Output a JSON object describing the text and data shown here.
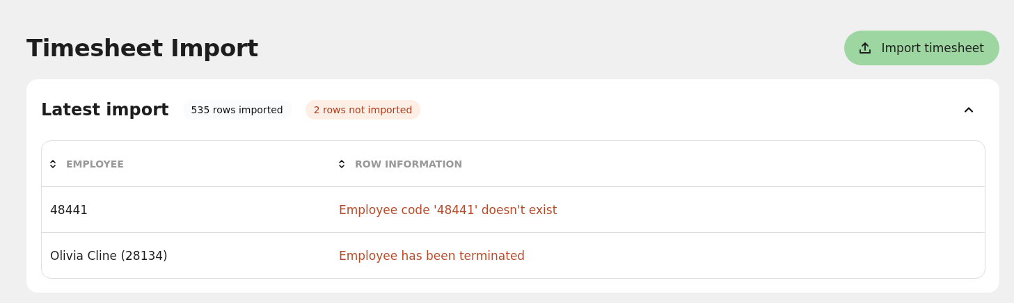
{
  "page": {
    "title": "Timesheet Import"
  },
  "import_button": {
    "label": "Import timesheet"
  },
  "latest_import": {
    "title": "Latest import",
    "expanded": true,
    "badges": [
      {
        "label": "535 rows imported",
        "kind": "success"
      },
      {
        "label": "2 rows not imported",
        "kind": "error"
      }
    ],
    "table": {
      "columns": [
        "EMPLOYEE",
        "ROW INFORMATION"
      ],
      "rows": [
        {
          "employee": "48441",
          "info": "Employee code '48441' doesn't exist"
        },
        {
          "employee": "Olivia Cline (28134)",
          "info": "Employee has been terminated"
        }
      ]
    }
  }
}
